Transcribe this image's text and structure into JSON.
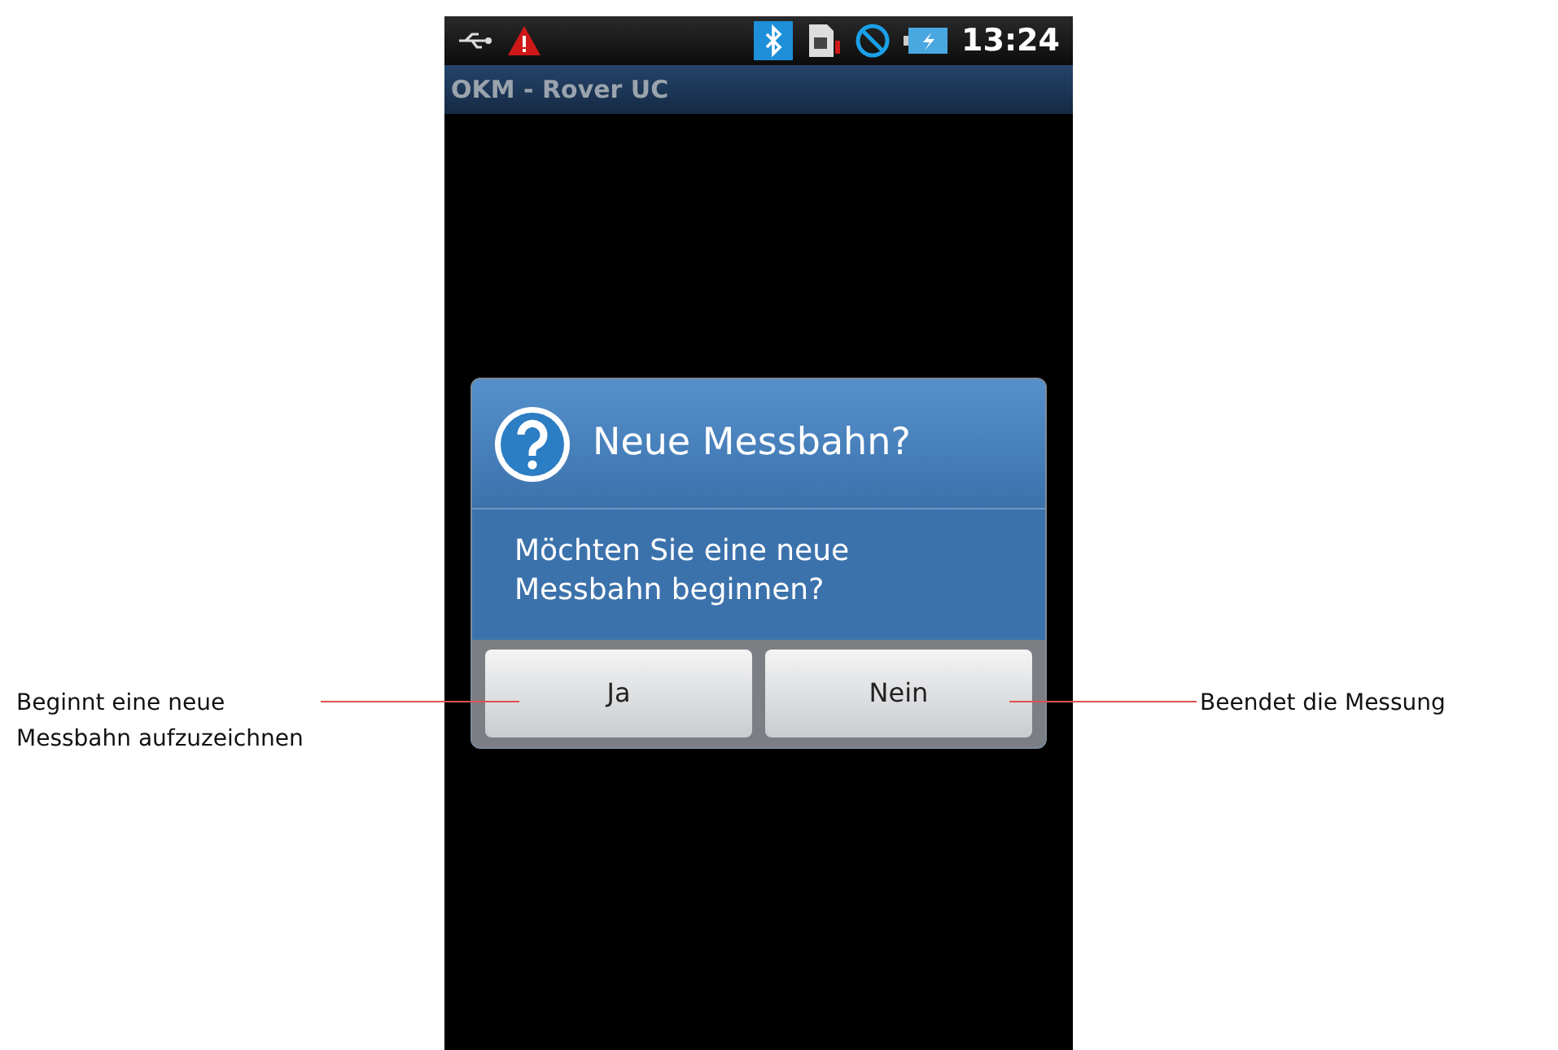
{
  "status_bar": {
    "time": "13:24"
  },
  "app_bar": {
    "title": "OKM - Rover UC"
  },
  "dialog": {
    "title": "Neue Messbahn?",
    "message": "Möchten Sie eine neue Messbahn beginnen?",
    "buttons": [
      "Ja",
      "Nein"
    ]
  },
  "annotations": {
    "left": {
      "text": "Beginnt eine neue Messbahn aufzuzeichnen"
    },
    "right": {
      "text": "Beendet die Messung"
    }
  }
}
